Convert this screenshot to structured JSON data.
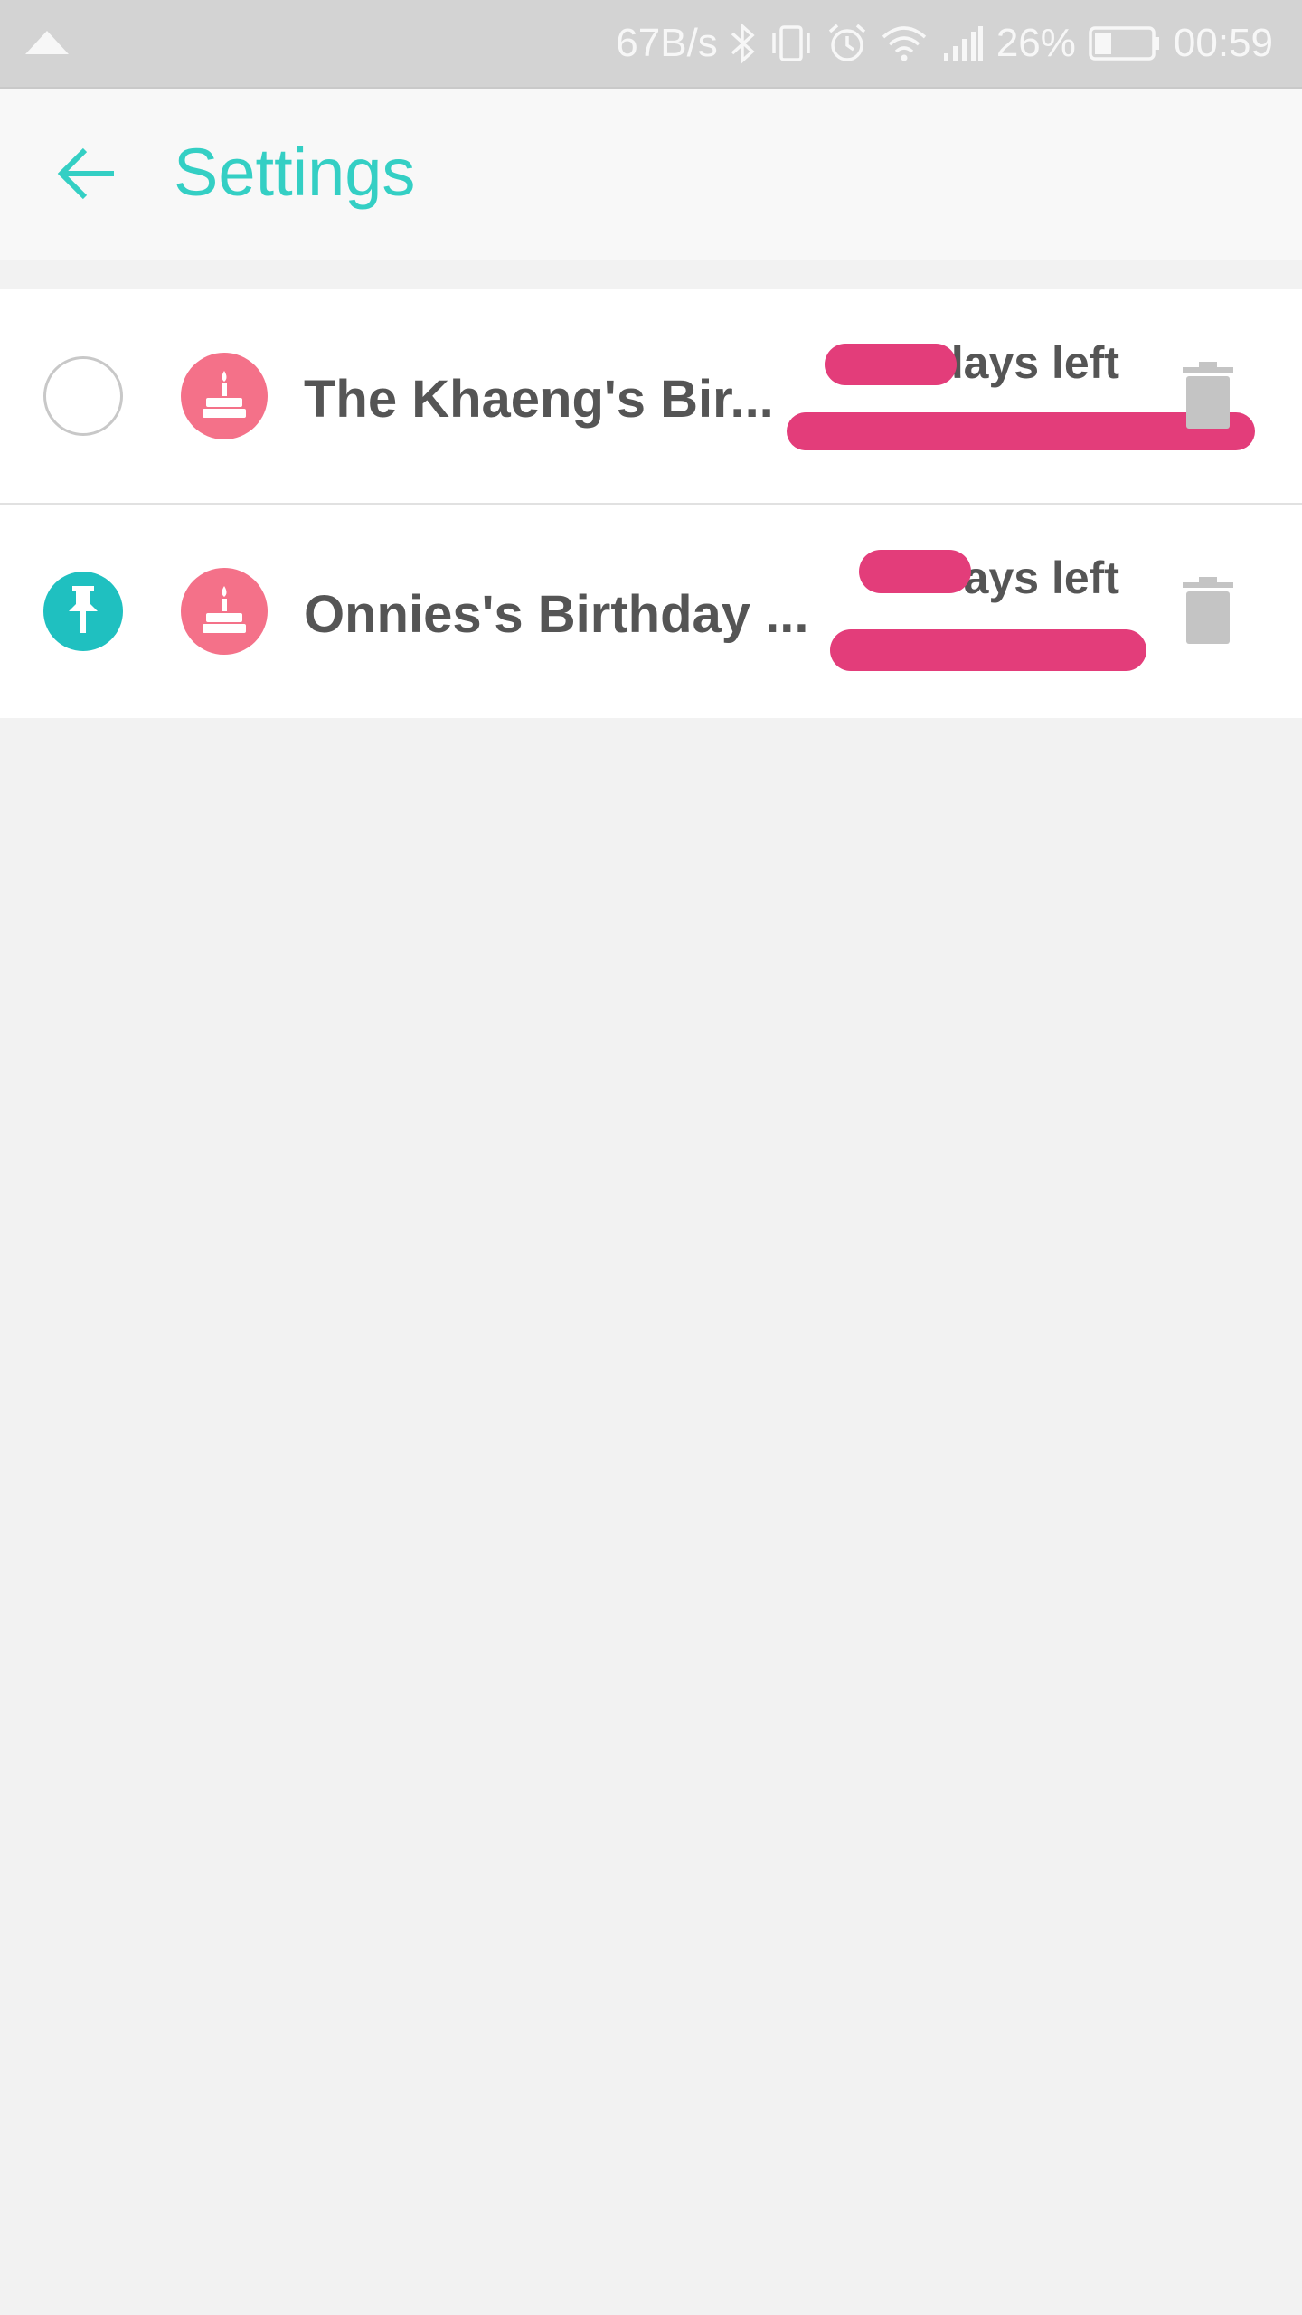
{
  "status_bar": {
    "speed": "67B/s",
    "battery": "26%",
    "time": "00:59",
    "icons": [
      "notification-arrow-icon",
      "bluetooth-icon",
      "vibrate-icon",
      "alarm-icon",
      "wifi-icon",
      "signal-icon",
      "battery-icon"
    ]
  },
  "app_bar": {
    "title": "Settings",
    "back_icon": "arrow-left-icon"
  },
  "events": [
    {
      "name": "The Khaeng's Bir...",
      "days_left": "days left",
      "pinned": false,
      "icon": "birthday-cake-icon"
    },
    {
      "name": "Onnies's Birthday ...",
      "days_left": "ays left",
      "pinned": true,
      "icon": "birthday-cake-icon"
    }
  ],
  "colors": {
    "accent": "#34cfc4",
    "pin_active": "#1fc0c0",
    "event_icon": "#f47189",
    "redaction": "#e33d7a",
    "text": "#555555",
    "trash": "#c4c4c4"
  }
}
